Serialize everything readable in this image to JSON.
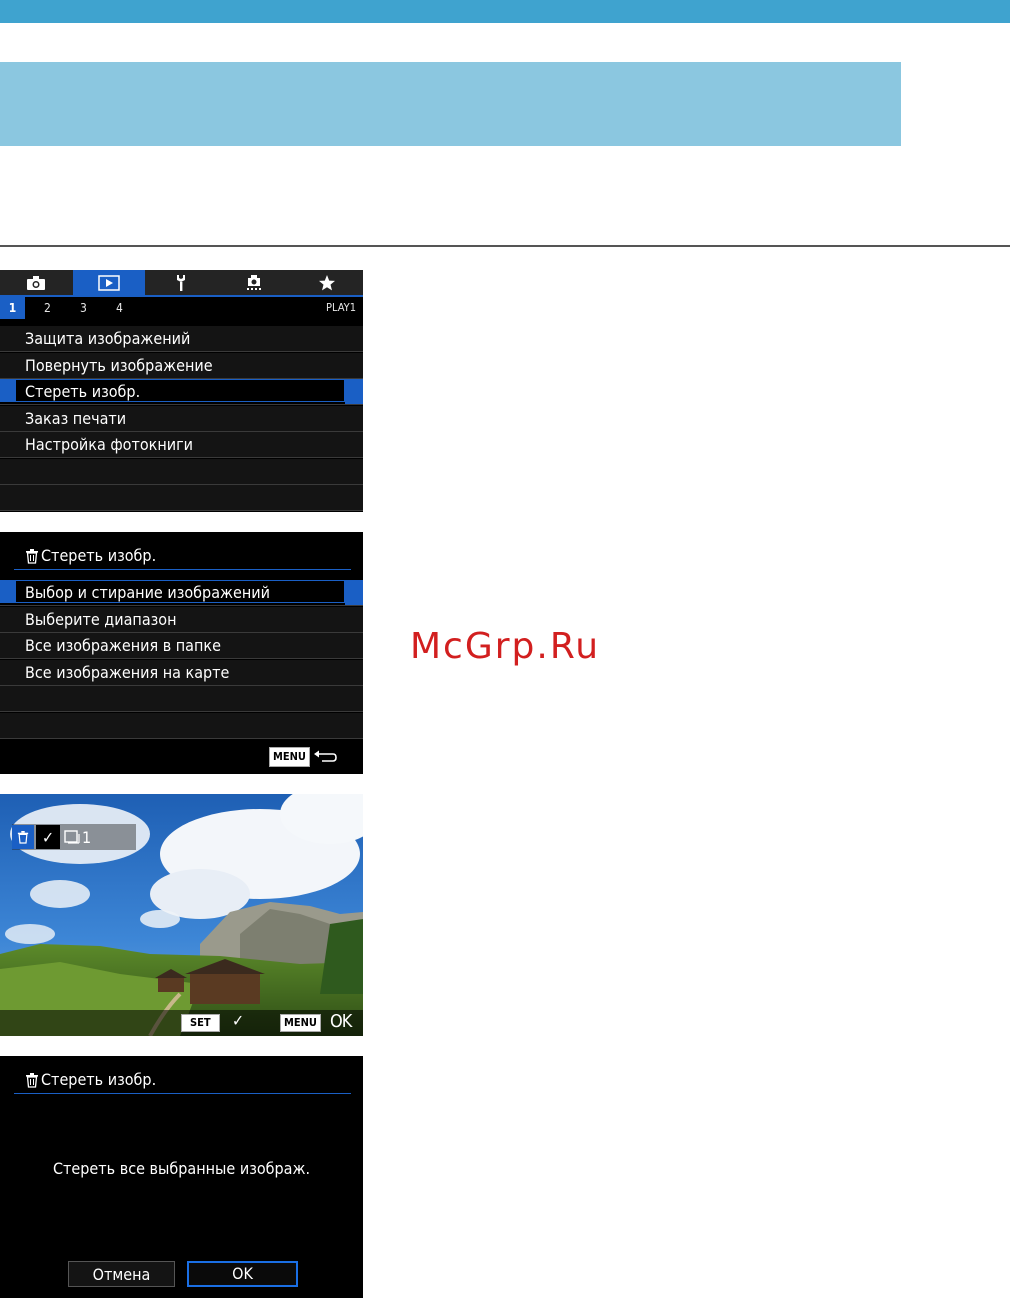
{
  "watermark": "McGrp.Ru",
  "colors": {
    "top_bar": "#3fa3cf",
    "title_band": "#8bc7e0",
    "camera_accent": "#1a5fc5",
    "watermark": "#d21f1f"
  },
  "screen1": {
    "tabs": [
      {
        "icon": "camera-icon"
      },
      {
        "icon": "playback-icon",
        "active": true
      },
      {
        "icon": "wrench-icon"
      },
      {
        "icon": "custom-function-icon"
      },
      {
        "icon": "star-icon"
      }
    ],
    "subtabs": [
      "1",
      "2",
      "3",
      "4"
    ],
    "active_subtab": "1",
    "page_label": "PLAY1",
    "items": [
      "Защита изображений",
      "Повернуть изображение",
      "Стереть изобр.",
      "Заказ печати",
      "Настройка фотокниги"
    ],
    "selected_index": 2
  },
  "screen2": {
    "title": "Стереть изобр.",
    "items": [
      "Выбор и стирание изображений",
      "Выберите диапазон",
      "Все изображения в папке",
      "Все изображения на карте"
    ],
    "selected_index": 0,
    "menu_label": "MENU"
  },
  "screen3": {
    "check_mark": "✓",
    "count": "1",
    "set_label": "SET",
    "menu_label": "MENU",
    "ok_label": "OK"
  },
  "screen4": {
    "title": "Стереть изобр.",
    "message": "Стереть все выбранные изображ.",
    "cancel_label": "Отмена",
    "ok_label": "OK"
  }
}
